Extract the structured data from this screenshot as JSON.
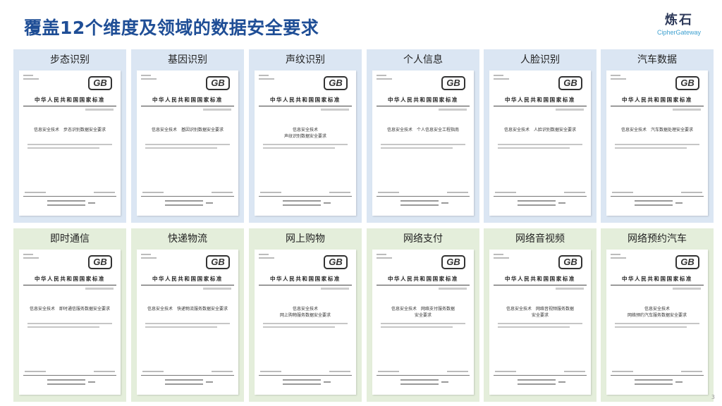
{
  "header": {
    "title": "覆盖12个维度及领域的数据安全要求",
    "brand_cn": "炼石",
    "brand_en": "CipherGateway"
  },
  "document_common": {
    "logo_text": "GB",
    "standard_title": "中华人民共和国国家标准"
  },
  "rows": [
    {
      "theme": "blue",
      "cards": [
        {
          "label": "步态识别",
          "spec": "信息安全技术　步态识别数据安全要求"
        },
        {
          "label": "基因识别",
          "spec": "信息安全技术　基因识别数据安全要求"
        },
        {
          "label": "声纹识别",
          "spec": "信息安全技术\n声纹识别数据安全要求"
        },
        {
          "label": "个人信息",
          "spec": "信息安全技术　个人信息安全工程指南"
        },
        {
          "label": "人脸识别",
          "spec": "信息安全技术　人脸识别数据安全要求"
        },
        {
          "label": "汽车数据",
          "spec": "信息安全技术　汽车数据处理安全要求"
        }
      ]
    },
    {
      "theme": "green",
      "cards": [
        {
          "label": "即时通信",
          "spec": "信息安全技术　即时通信服务数据安全要求"
        },
        {
          "label": "快递物流",
          "spec": "信息安全技术　快递物流服务数据安全要求"
        },
        {
          "label": "网上购物",
          "spec": "信息安全技术\n网上购物服务数据安全要求"
        },
        {
          "label": "网络支付",
          "spec": "信息安全技术　网络支付服务数据\n安全要求"
        },
        {
          "label": "网络音视频",
          "spec": "信息安全技术　网络音视频服务数据\n安全要求"
        },
        {
          "label": "网络预约汽车",
          "spec": "信息安全技术\n网络预约汽车服务数据安全要求"
        }
      ]
    }
  ],
  "page_number": "3"
}
